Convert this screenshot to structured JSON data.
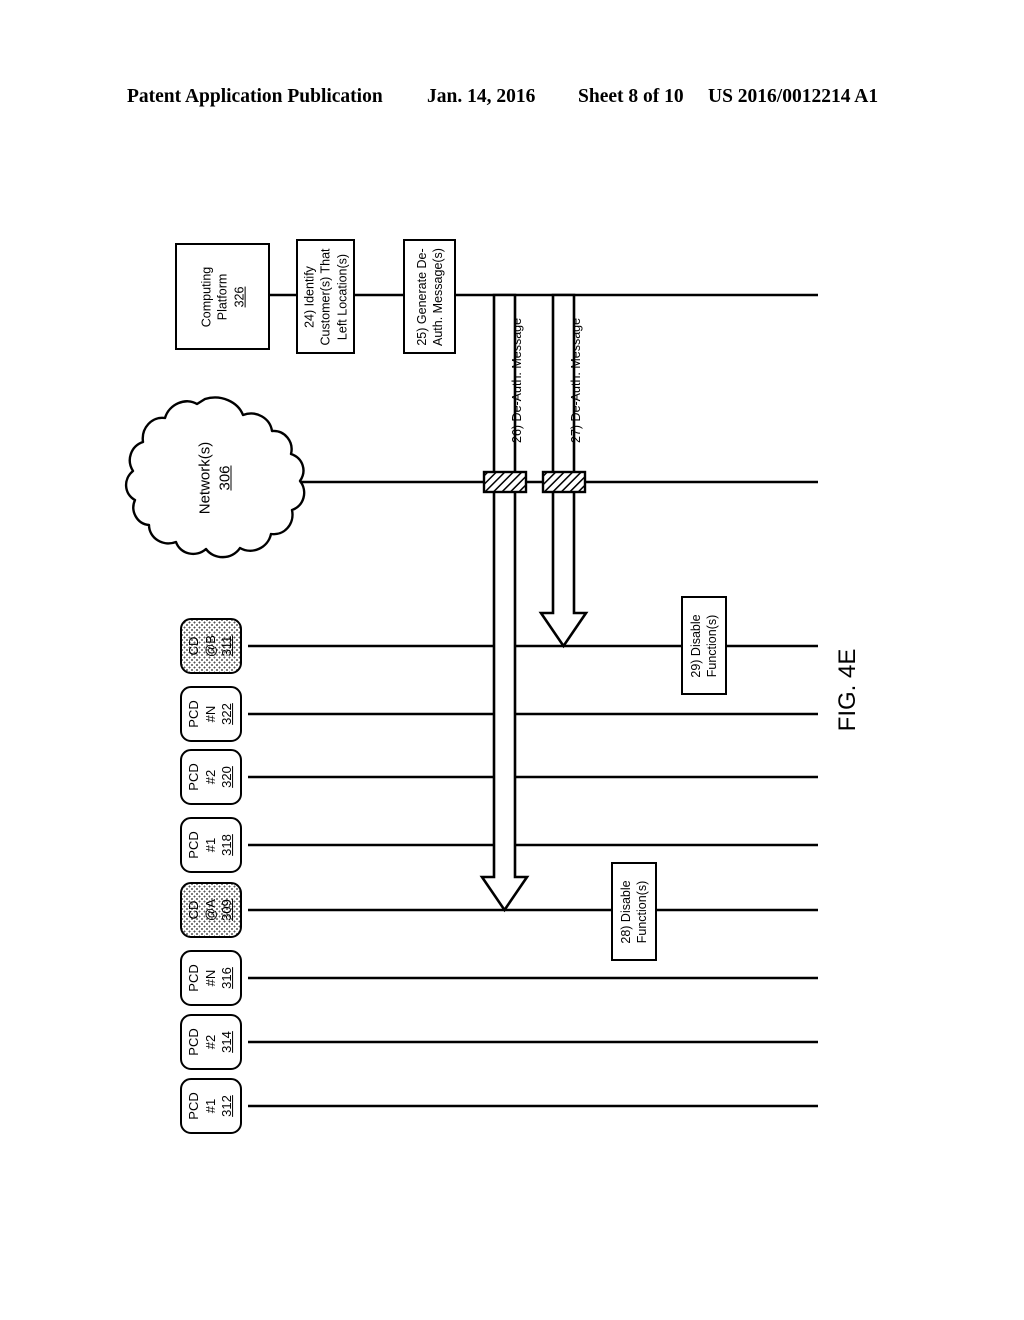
{
  "header": {
    "publication": "Patent Application Publication",
    "date": "Jan. 14, 2016",
    "sheet": "Sheet 8 of 10",
    "number": "US 2016/0012214 A1"
  },
  "figure": {
    "caption": "FIG. 4E",
    "cloud": {
      "label": "Network(s)",
      "ref": "306"
    },
    "platform": {
      "label_line1": "Computing",
      "label_line2": "Platform",
      "ref": "326"
    },
    "process_steps": [
      {
        "id": "step-24",
        "line1": "24) Identify",
        "line2": "Customer(s) That",
        "line3": "Left Location(s)"
      },
      {
        "id": "step-25",
        "line1": "25) Generate De-",
        "line2": "Auth. Message(s)",
        "line3": ""
      },
      {
        "id": "step-29",
        "line1": "29) Disable",
        "line2": "Function(s)",
        "line3": ""
      },
      {
        "id": "step-28",
        "line1": "28) Disable",
        "line2": "Function(s)",
        "line3": ""
      }
    ],
    "messages": [
      {
        "id": "msg-26",
        "label": "26) De-Auth. Message"
      },
      {
        "id": "msg-27",
        "label": "27) De-Auth. Message"
      }
    ],
    "devices": [
      {
        "id": "dev-311",
        "line1": "CD",
        "line2": "@B",
        "ref": "311",
        "stippled": true
      },
      {
        "id": "dev-322",
        "line1": "PCD",
        "line2": "#N",
        "ref": "322",
        "stippled": false
      },
      {
        "id": "dev-320",
        "line1": "PCD",
        "line2": "#2",
        "ref": "320",
        "stippled": false
      },
      {
        "id": "dev-318",
        "line1": "PCD",
        "line2": "#1",
        "ref": "318",
        "stippled": false
      },
      {
        "id": "dev-309",
        "line1": "CD",
        "line2": "@A",
        "ref": "309",
        "stippled": true
      },
      {
        "id": "dev-316",
        "line1": "PCD",
        "line2": "#N",
        "ref": "316",
        "stippled": false
      },
      {
        "id": "dev-314",
        "line1": "PCD",
        "line2": "#2",
        "ref": "314",
        "stippled": false
      },
      {
        "id": "dev-312",
        "line1": "PCD",
        "line2": "#1",
        "ref": "312",
        "stippled": false
      }
    ],
    "colors": {
      "stroke": "#000000",
      "background": "#ffffff",
      "hatch": "#000000"
    }
  }
}
